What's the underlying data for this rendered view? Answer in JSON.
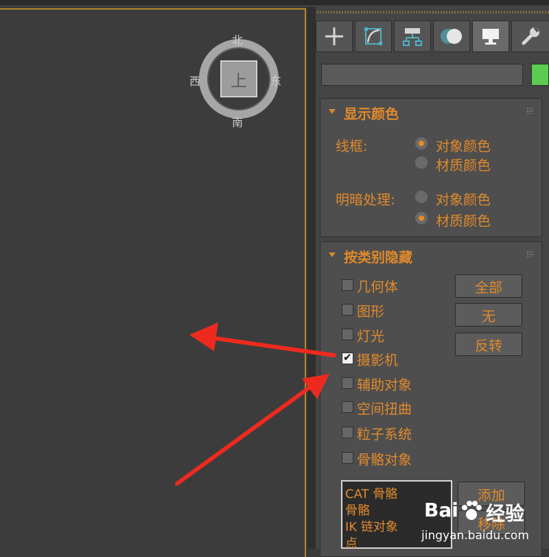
{
  "viewcube": {
    "face": "上",
    "north": "北",
    "south": "南",
    "east": "东",
    "west": "西"
  },
  "tabs": [
    {
      "icon": "plus-icon"
    },
    {
      "icon": "modify-icon"
    },
    {
      "icon": "hierarchy-icon"
    },
    {
      "icon": "motion-icon"
    },
    {
      "icon": "display-icon",
      "active": true
    },
    {
      "icon": "wrench-icon"
    }
  ],
  "name_field": {
    "value": ""
  },
  "color_swatch": "#5bcc4f",
  "display_color": {
    "title": "显示颜色",
    "wireframe_label": "线框:",
    "wireframe_options": [
      "对象颜色",
      "材质颜色"
    ],
    "wireframe_selected": 0,
    "shaded_label": "明暗处理:",
    "shaded_options": [
      "对象颜色",
      "材质颜色"
    ],
    "shaded_selected": 1
  },
  "hide_by_category": {
    "title": "按类别隐藏",
    "items": [
      {
        "label": "几何体",
        "checked": false
      },
      {
        "label": "图形",
        "checked": false
      },
      {
        "label": "灯光",
        "checked": false
      },
      {
        "label": "摄影机",
        "checked": true
      },
      {
        "label": "辅助对象",
        "checked": false
      },
      {
        "label": "空间扭曲",
        "checked": false
      },
      {
        "label": "粒子系统",
        "checked": false
      },
      {
        "label": "骨骼对象",
        "checked": false
      }
    ],
    "buttons": {
      "all": "全部",
      "none": "无",
      "invert": "反转"
    },
    "list": [
      "CAT 骨骼",
      "骨骼",
      "IK 链对象",
      "点"
    ],
    "add_button": "添加",
    "remove_button": "移除"
  },
  "watermark": {
    "brand": "Bai",
    "brand_cn": "经验",
    "url": "jingyan.baidu.com"
  }
}
